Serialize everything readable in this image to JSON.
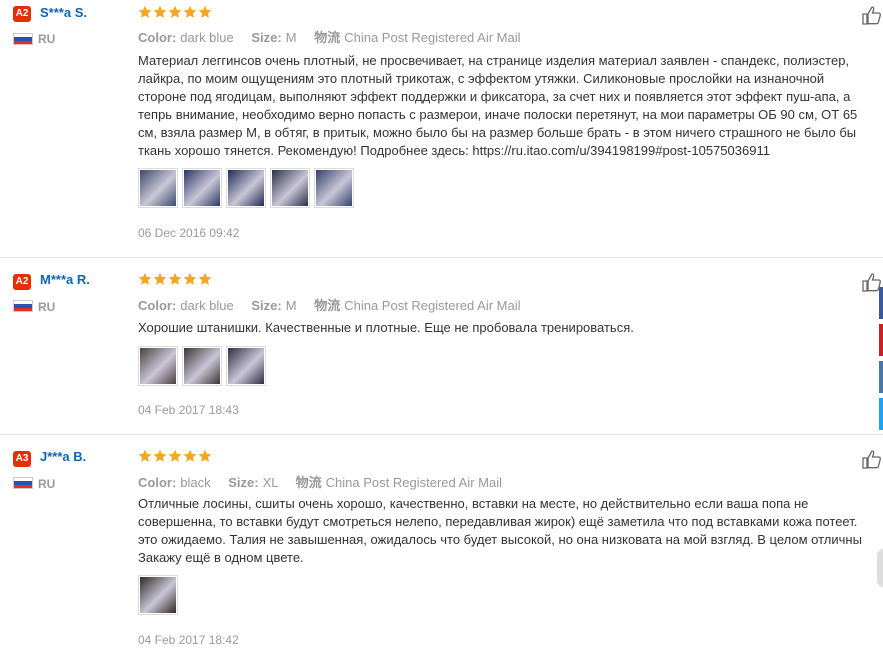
{
  "reviews": [
    {
      "badge": "A2",
      "name": "S***a S.",
      "country": "RU",
      "rating": 5,
      "color_label": "Color:",
      "color_value": "dark blue",
      "size_label": "Size:",
      "size_value": "M",
      "shipping_label": "物流",
      "shipping_value": "China Post Registered Air Mail",
      "text": "Материал леггинсов очень плотный, не просвечивает, на странице изделия материал заявлен - спандекс, полиэстер,\nлайкра, по моим ощущениям это плотный трикотаж, с эффектом утяжки. Силиконовые прослойки на изнаночной\nстороне под ягодицам, выполняют эффект поддержки и фиксатора, за счет них и появляется этот эффект пуш-апа, а\nтепрь внимание, необходимо верно попасть с размерои, иначе полоски перетянут, на мои параметры ОБ 90 см, ОТ 65\nсм, взяла размер М, в обтяг, в притык, можно было бы на размер больше брать - в этом ничего страшного не было бы\nткань хорошо тянется. Рекомендую! Подробнее здесь: https://ru.itao.com/u/394198199#post-10575036911",
      "photos": [
        "#3a4a6a",
        "#2b3566",
        "#1f2a55",
        "#2a2f4a",
        "#33406e"
      ],
      "date": "06 Dec 2016 09:42"
    },
    {
      "badge": "A2",
      "name": "M***a R.",
      "country": "RU",
      "rating": 5,
      "color_label": "Color:",
      "color_value": "dark blue",
      "size_label": "Size:",
      "size_value": "M",
      "shipping_label": "物流",
      "shipping_value": "China Post Registered Air Mail",
      "text": "Хорошие штанишки. Качественные и плотные. Еще не пробовала тренироваться.",
      "photos": [
        "#4a4040",
        "#3b3535",
        "#2d2f45"
      ],
      "date": "04 Feb 2017 18:43"
    },
    {
      "badge": "A3",
      "name": "J***a B.",
      "country": "RU",
      "rating": 5,
      "color_label": "Color:",
      "color_value": "black",
      "size_label": "Size:",
      "size_value": "XL",
      "shipping_label": "物流",
      "shipping_value": "China Post Registered Air Mail",
      "text": "Отличные лосины, сшиты очень хорошо, качественно, вставки на месте, но действительно если ваша попа не\nсовершенна, то вставки будут смотреться нелепо, передавливая жирок) ещё заметила что под вставками кожа потеет.\nэто ожидаемо. Талия не завышенная, ожидалось что будет высокой, но она низковата на мой взгляд. В целом отличны\nЗакажу ещё в одном цвете.",
      "photos": [
        "#2f2a25"
      ],
      "date": "04 Feb 2017 18:42"
    }
  ],
  "colors": {
    "badge": "#e62e04",
    "name": "#0d65b7",
    "star": "#f5a623",
    "share_facebook": "#3b5998",
    "share_pinterest": "#cb2027",
    "share_vk": "#4c75a3",
    "share_twitter": "#1da1f2"
  },
  "icons": [
    "thumbs-up-icon",
    "star-icon",
    "russia-flag-icon"
  ]
}
